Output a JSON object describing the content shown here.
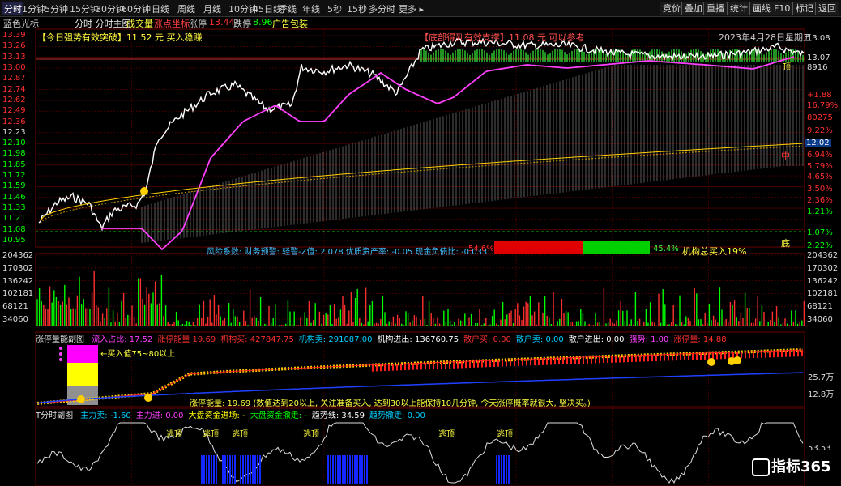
{
  "toolbar": {
    "tabs": [
      "分时",
      "1分钟",
      "5分钟",
      "15分钟",
      "30分钟",
      "60分钟",
      "日线",
      "周线",
      "月线",
      "10分钟",
      "45日线",
      "季线",
      "年线",
      "5秒",
      "15秒",
      "多分时",
      "更多 ▸"
    ],
    "active_tab": 0,
    "right_buttons": [
      "竞价",
      "叠加",
      "重播",
      "统计",
      "画线",
      "F10",
      "标记",
      "返回"
    ]
  },
  "subbar": {
    "cursor_label": "蓝色光标",
    "chart_title": "分时 分时主图",
    "vol_label": "成交量",
    "limit_label": "涨点坐标",
    "limit_up_label": "涨停",
    "limit_up_value": "13.44",
    "limit_down_label": "跌停",
    "limit_down_value": "8.96",
    "ad_label": "广告包装"
  },
  "main": {
    "left_axis": [
      "13.39",
      "13.26",
      "13.13",
      "13.00",
      "12.87",
      "12.74",
      "12.62",
      "12.49",
      "12.36",
      "12.23",
      "12.10",
      "11.98",
      "11.85",
      "11.72",
      "11.59",
      "11.46",
      "11.33",
      "11.21",
      "11.08",
      "10.95"
    ],
    "right_axis": [
      "13.08",
      "13.07",
      "8916",
      "+1.88",
      "16.79%",
      "80275",
      "9.22%",
      "12.02",
      "6.94%",
      "5.79%",
      "4.65%",
      "3.50%",
      "2.36%",
      "1.21%",
      "1.07%",
      "2.22%"
    ],
    "price_tag": "12.02",
    "signal_buy": "【今日强势有效突破】11.52 元 买入稳赚",
    "signal_bottom": "【底部得到有效支撑】11.08 元 可以参考",
    "date": "2023年4月28日星期五",
    "risk_text": "风险系数: 财务预警: 轻警-Z值: 2.078 优质资产率: -0.05 现金负债比: -0.033",
    "risk_pct": "54.6%",
    "green_pct": "45.4%",
    "inst_text": "机构总买入19%",
    "mid_char": "中",
    "bottom_char": "底",
    "top_char": "顶"
  },
  "volume": {
    "left_axis": [
      "204362",
      "170302",
      "136242",
      "102181",
      "68121",
      "34060"
    ],
    "right_axis": [
      "204362",
      "170302",
      "136242",
      "102181",
      "68121",
      "34060"
    ]
  },
  "energy": {
    "title": "涨停量能副图",
    "items": [
      {
        "label": "流入占比:",
        "value": "17.52",
        "color": "#ff40ff"
      },
      {
        "label": "涨停能量",
        "value": "19.69",
        "color": "#ff3030"
      },
      {
        "label": "机构买:",
        "value": "427847.75",
        "color": "#ff3030"
      },
      {
        "label": "机构卖:",
        "value": "291087.00",
        "color": "#00d0ff"
      },
      {
        "label": "机构进出:",
        "value": "136760.75",
        "color": "#ffffff"
      },
      {
        "label": "散户买:",
        "value": "0.00",
        "color": "#ff3030"
      },
      {
        "label": "散户卖:",
        "value": "0.00",
        "color": "#00d0ff"
      },
      {
        "label": "散户进出:",
        "value": "0.00",
        "color": "#ffffff"
      },
      {
        "label": "强势:",
        "value": "1.00",
        "color": "#ff40ff"
      },
      {
        "label": "涨停量:",
        "value": "14.88",
        "color": "#ff3030"
      }
    ],
    "arrow_note": "←买入值75~80以上",
    "energy_note": "涨停能量: 19.69 (数值达到20以上, 关注准备买入, 达到30以上能保持10几分钟, 今天涨停概率就很大, 坚决买。)",
    "right_axis": [
      "25.7万",
      "12.8万"
    ]
  },
  "t_panel": {
    "title": "T分时副图",
    "items": [
      {
        "label": "主力卖:",
        "value": "-1.60",
        "color": "#00d0ff"
      },
      {
        "label": "主力进:",
        "value": "0.00",
        "color": "#ff40ff"
      },
      {
        "label": "大盘资金进场:",
        "value": "-",
        "color": "#ffff00"
      },
      {
        "label": "大盘资金撤走:",
        "value": "-",
        "color": "#00ff00"
      },
      {
        "label": "趋势线:",
        "value": "34.59",
        "color": "#ffffff"
      },
      {
        "label": "趋势撤走:",
        "value": "0.00",
        "color": "#00d0ff"
      }
    ],
    "escape_label": "逃顶",
    "right_value": "53.53",
    "watermark": "指标365"
  },
  "colors": {
    "price_line": "#ffffff",
    "avg_line": "#ff40ff",
    "grid": "#6a0000",
    "up": "#ff3030",
    "down": "#00ff00",
    "accent": "#ffff00"
  }
}
